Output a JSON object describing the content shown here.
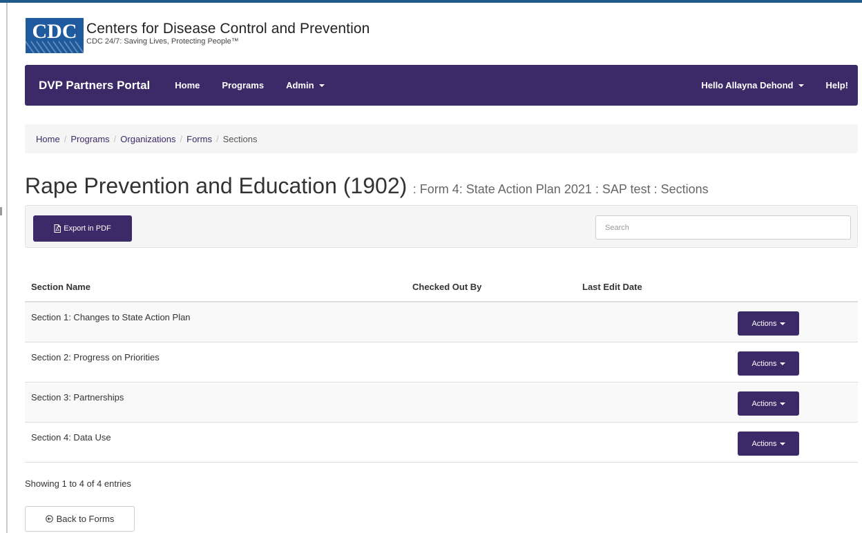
{
  "cdc": {
    "logo_text": "CDC",
    "title": "Centers for Disease Control and Prevention",
    "tagline": "CDC 24/7: Saving Lives, Protecting People™"
  },
  "navbar": {
    "brand": "DVP Partners Portal",
    "items": [
      {
        "label": "Home"
      },
      {
        "label": "Programs"
      },
      {
        "label": "Admin"
      }
    ],
    "user_label": "Hello Allayna Dehond",
    "help_label": "Help!"
  },
  "breadcrumb": [
    "Home",
    "Programs",
    "Organizations",
    "Forms",
    "Sections"
  ],
  "page": {
    "title": "Rape Prevention and Education (1902)",
    "subtitle": ": Form 4: State Action Plan 2021 : SAP test : Sections"
  },
  "toolbar": {
    "export_label": "Export in PDF",
    "search_placeholder": "Search"
  },
  "table": {
    "headers": {
      "section_name": "Section Name",
      "checked_out_by": "Checked Out By",
      "last_edit_date": "Last Edit Date"
    },
    "rows": [
      {
        "name": "Section 1: Changes to State Action Plan",
        "checked_out_by": "",
        "last_edit_date": "",
        "action_label": "Actions"
      },
      {
        "name": "Section 2: Progress on Priorities",
        "checked_out_by": "",
        "last_edit_date": "",
        "action_label": "Actions"
      },
      {
        "name": "Section 3: Partnerships",
        "checked_out_by": "",
        "last_edit_date": "",
        "action_label": "Actions"
      },
      {
        "name": "Section 4: Data Use",
        "checked_out_by": "",
        "last_edit_date": "",
        "action_label": "Actions"
      }
    ]
  },
  "info": "Showing 1 to 4 of 4 entries",
  "back_label": "Back to Forms",
  "colors": {
    "brand_purple": "#3b2a67",
    "logo_blue": "#1f5a9e",
    "breadcrumb_bg": "#f5f5f5"
  }
}
